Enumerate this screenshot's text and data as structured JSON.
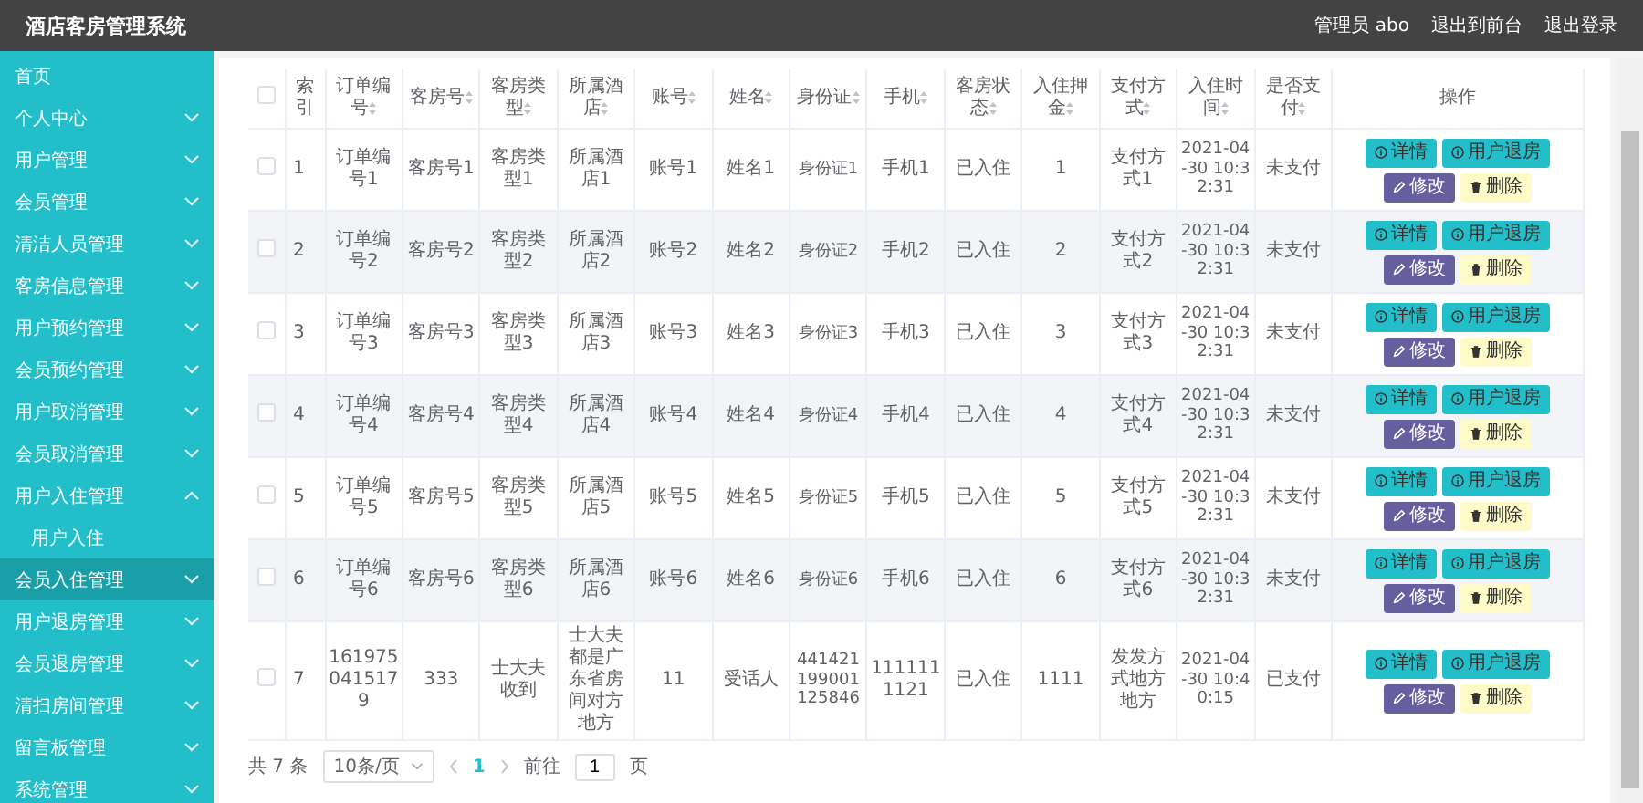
{
  "header": {
    "title": "酒店客房管理系统",
    "user": "管理员 abo",
    "links": [
      "退出到前台",
      "退出登录"
    ]
  },
  "sidebar": {
    "items": [
      {
        "label": "首页",
        "selected": false
      },
      {
        "label": "个人中心",
        "selected": false,
        "expanded": false
      },
      {
        "label": "用户管理",
        "selected": false,
        "expanded": false
      },
      {
        "label": "会员管理",
        "selected": false,
        "expanded": false
      },
      {
        "label": "清洁人员管理",
        "selected": false,
        "expanded": false
      },
      {
        "label": "客房信息管理",
        "selected": false,
        "expanded": false
      },
      {
        "label": "用户预约管理",
        "selected": false,
        "expanded": false
      },
      {
        "label": "会员预约管理",
        "selected": false,
        "expanded": false
      },
      {
        "label": "用户取消管理",
        "selected": false,
        "expanded": false
      },
      {
        "label": "会员取消管理",
        "selected": false,
        "expanded": false
      },
      {
        "label": "用户入住管理",
        "selected": false,
        "expanded": true,
        "children": [
          {
            "label": "用户入住",
            "selected": false
          }
        ]
      },
      {
        "label": "会员入住管理",
        "selected": true,
        "expanded": false
      },
      {
        "label": "用户退房管理",
        "selected": false,
        "expanded": false
      },
      {
        "label": "会员退房管理",
        "selected": false,
        "expanded": false
      },
      {
        "label": "清扫房间管理",
        "selected": false,
        "expanded": false
      },
      {
        "label": "留言板管理",
        "selected": false,
        "expanded": false
      },
      {
        "label": "系统管理",
        "selected": false,
        "expanded": false
      }
    ]
  },
  "table": {
    "select_all": {
      "checked": false
    },
    "columns": [
      {
        "label": "索引",
        "sortable": false
      },
      {
        "label": "订单编号",
        "sortable": true
      },
      {
        "label": "客房号",
        "sortable": true
      },
      {
        "label": "客房类型",
        "sortable": true
      },
      {
        "label": "所属酒店",
        "sortable": true
      },
      {
        "label": "账号",
        "sortable": true
      },
      {
        "label": "姓名",
        "sortable": true
      },
      {
        "label": "身份证",
        "sortable": true
      },
      {
        "label": "手机",
        "sortable": true
      },
      {
        "label": "客房状态",
        "sortable": true
      },
      {
        "label": "入住押金",
        "sortable": true
      },
      {
        "label": "支付方式",
        "sortable": true
      },
      {
        "label": "入住时间",
        "sortable": true
      },
      {
        "label": "是否支付",
        "sortable": true
      },
      {
        "label": "操作",
        "sortable": false
      }
    ],
    "rows": [
      {
        "checked": false,
        "cells": [
          "1",
          "订单编号1",
          "客房号1",
          "客房类型1",
          "所属酒店1",
          "账号1",
          "姓名1",
          "身份证1",
          "手机1",
          "已入住",
          "1",
          "支付方式1",
          "2021-04-30 10:32:31",
          "未支付"
        ],
        "actions": [
          {
            "kind": "detail",
            "label": "详情"
          },
          {
            "kind": "checkout",
            "label": "用户退房"
          },
          {
            "kind": "edit",
            "label": "修改"
          },
          {
            "kind": "delete",
            "label": "删除"
          }
        ]
      },
      {
        "checked": false,
        "cells": [
          "2",
          "订单编号2",
          "客房号2",
          "客房类型2",
          "所属酒店2",
          "账号2",
          "姓名2",
          "身份证2",
          "手机2",
          "已入住",
          "2",
          "支付方式2",
          "2021-04-30 10:32:31",
          "未支付"
        ],
        "actions": [
          {
            "kind": "detail",
            "label": "详情"
          },
          {
            "kind": "checkout",
            "label": "用户退房"
          },
          {
            "kind": "edit",
            "label": "修改"
          },
          {
            "kind": "delete",
            "label": "删除"
          }
        ]
      },
      {
        "checked": false,
        "cells": [
          "3",
          "订单编号3",
          "客房号3",
          "客房类型3",
          "所属酒店3",
          "账号3",
          "姓名3",
          "身份证3",
          "手机3",
          "已入住",
          "3",
          "支付方式3",
          "2021-04-30 10:32:31",
          "未支付"
        ],
        "actions": [
          {
            "kind": "detail",
            "label": "详情"
          },
          {
            "kind": "checkout",
            "label": "用户退房"
          },
          {
            "kind": "edit",
            "label": "修改"
          },
          {
            "kind": "delete",
            "label": "删除"
          }
        ]
      },
      {
        "checked": false,
        "cells": [
          "4",
          "订单编号4",
          "客房号4",
          "客房类型4",
          "所属酒店4",
          "账号4",
          "姓名4",
          "身份证4",
          "手机4",
          "已入住",
          "4",
          "支付方式4",
          "2021-04-30 10:32:31",
          "未支付"
        ],
        "actions": [
          {
            "kind": "detail",
            "label": "详情"
          },
          {
            "kind": "checkout",
            "label": "用户退房"
          },
          {
            "kind": "edit",
            "label": "修改"
          },
          {
            "kind": "delete",
            "label": "删除"
          }
        ]
      },
      {
        "checked": false,
        "cells": [
          "5",
          "订单编号5",
          "客房号5",
          "客房类型5",
          "所属酒店5",
          "账号5",
          "姓名5",
          "身份证5",
          "手机5",
          "已入住",
          "5",
          "支付方式5",
          "2021-04-30 10:32:31",
          "未支付"
        ],
        "actions": [
          {
            "kind": "detail",
            "label": "详情"
          },
          {
            "kind": "checkout",
            "label": "用户退房"
          },
          {
            "kind": "edit",
            "label": "修改"
          },
          {
            "kind": "delete",
            "label": "删除"
          }
        ]
      },
      {
        "checked": false,
        "cells": [
          "6",
          "订单编号6",
          "客房号6",
          "客房类型6",
          "所属酒店6",
          "账号6",
          "姓名6",
          "身份证6",
          "手机6",
          "已入住",
          "6",
          "支付方式6",
          "2021-04-30 10:32:31",
          "未支付"
        ],
        "actions": [
          {
            "kind": "detail",
            "label": "详情"
          },
          {
            "kind": "checkout",
            "label": "用户退房"
          },
          {
            "kind": "edit",
            "label": "修改"
          },
          {
            "kind": "delete",
            "label": "删除"
          }
        ]
      },
      {
        "checked": false,
        "cells": [
          "7",
          "1619750415179",
          "333",
          "士大夫收到",
          "士大夫都是广东省房间对方地方",
          "11",
          "受话人",
          "441421199001125846",
          "1111111121",
          "已入住",
          "1111",
          "发发方式地方地方",
          "2021-04-30 10:40:15",
          "已支付"
        ],
        "actions": [
          {
            "kind": "detail",
            "label": "详情"
          },
          {
            "kind": "checkout",
            "label": "用户退房"
          },
          {
            "kind": "edit",
            "label": "修改"
          },
          {
            "kind": "delete",
            "label": "删除"
          }
        ]
      }
    ]
  },
  "pagination": {
    "total": "共 7 条",
    "page_size": "10条/页",
    "pages": [
      {
        "label": "1",
        "selected": true
      }
    ],
    "goto_label": "前往",
    "goto_value": "1",
    "goto_suffix": "页"
  }
}
